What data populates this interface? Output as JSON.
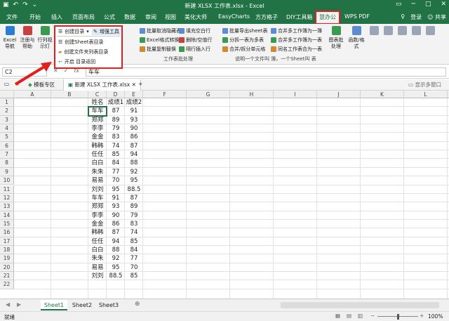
{
  "window": {
    "title": "新建 XLSX 工作表.xlsx - Excel",
    "login": "登录",
    "share": "共享"
  },
  "tabs": [
    "文件",
    "开始",
    "插入",
    "页面布局",
    "公式",
    "数据",
    "审阅",
    "视图",
    "美化大师",
    "EasyCharts",
    "方方格子",
    "DIY工具箱",
    "慧办公",
    "WPS PDF"
  ],
  "tab_highlighted": "慧办公",
  "ribbon": {
    "left_buttons": [
      {
        "label": "Excel\n导航"
      },
      {
        "label": "注册与\n帮助"
      },
      {
        "label": "行列视\n示灯"
      }
    ],
    "dropdown_button": "创建目录",
    "enhance_button": "增强工具",
    "col1": [
      "批量取消隐藏表",
      "Excel格式转换",
      "批量复制替换"
    ],
    "col2": [
      "填充空白行",
      "删除/空值行",
      "隔行插入行"
    ],
    "group1_label": "工作表批处理",
    "col3": [
      "批量导出sheet表",
      "分拆一表为多表",
      "合并/拆分单元格"
    ],
    "col4": [
      "合并多工作簿为一簿",
      "合并多工作簿为一表",
      "同名工作表合为一表"
    ],
    "group2_label": "说明一个文件叫 簿，一个Sheet叫 表",
    "right_buttons": [
      {
        "label": "图表批\n处理"
      },
      {
        "label": "函数/格\n式"
      }
    ]
  },
  "menu": {
    "items": [
      "创建Sheet表目录",
      "创建文件夹列表目录",
      "开启 目录返回"
    ]
  },
  "formula_bar": {
    "name_box": "C2",
    "fx": "fx",
    "content": "车车"
  },
  "file_tabs": {
    "template": "模板专区",
    "workbook": "新建 XLSX 工作表.xlsx",
    "add": "+",
    "show_windows": "显示多窗口"
  },
  "columns": [
    "A",
    "B",
    "C",
    "D",
    "E",
    "F",
    "G",
    "H",
    "I",
    "J",
    "K",
    "L",
    "M",
    "N",
    "O"
  ],
  "rows": [
    "1",
    "2",
    "3",
    "4",
    "5",
    "6",
    "7",
    "8",
    "9",
    "10",
    "11",
    "12",
    "13",
    "14",
    "15",
    "16",
    "17",
    "18",
    "19",
    "20",
    "21",
    "22"
  ],
  "table": {
    "headers": [
      "姓名",
      "成绩1",
      "成绩2"
    ],
    "data": [
      [
        "车车",
        "87",
        "91"
      ],
      [
        "郑郑",
        "89",
        "93"
      ],
      [
        "李李",
        "79",
        "90"
      ],
      [
        "金金",
        "83",
        "86"
      ],
      [
        "韩韩",
        "74",
        "87"
      ],
      [
        "任任",
        "85",
        "94"
      ],
      [
        "白白",
        "84",
        "88"
      ],
      [
        "朱朱",
        "77",
        "92"
      ],
      [
        "易易",
        "70",
        "95"
      ],
      [
        "刘刘",
        "95",
        "88.5"
      ],
      [
        "车车",
        "91",
        "87"
      ],
      [
        "郑郑",
        "93",
        "89"
      ],
      [
        "李李",
        "90",
        "79"
      ],
      [
        "金金",
        "86",
        "83"
      ],
      [
        "韩韩",
        "87",
        "74"
      ],
      [
        "任任",
        "94",
        "85"
      ],
      [
        "白白",
        "88",
        "84"
      ],
      [
        "朱朱",
        "92",
        "77"
      ],
      [
        "易易",
        "95",
        "70"
      ],
      [
        "刘刘",
        "88.5",
        "85"
      ]
    ]
  },
  "sheets": [
    "Sheet1",
    "Sheet2",
    "Sheet3"
  ],
  "active_sheet": "Sheet1",
  "status": {
    "ready": "就绪",
    "zoom": "100%"
  }
}
